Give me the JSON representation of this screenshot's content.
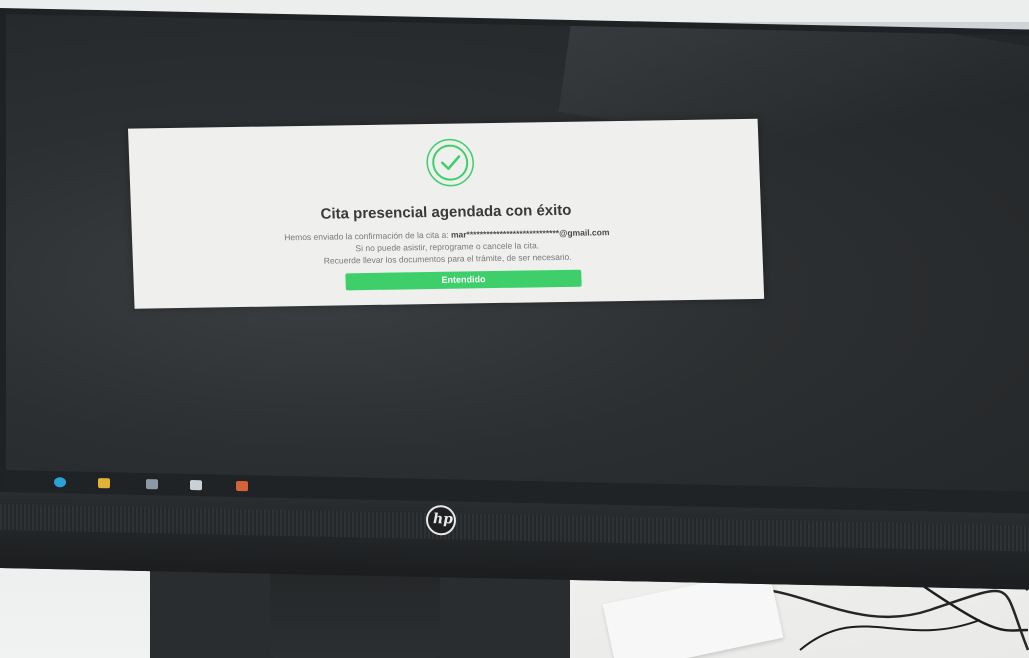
{
  "dialog": {
    "title": "Cita presencial agendada con éxito",
    "line1_prefix": "Hemos enviado la confirmación de la cita a: ",
    "line1_email": "mar****************************@gmail.com",
    "line2": "Si no puede asistir, reprograme o cancele la cita.",
    "line3": "Recuerde llevar los documentos para el trámite, de ser necesario.",
    "button_label": "Entendido",
    "icon": "check-circle-icon",
    "accent_color": "#3ecf6b"
  },
  "monitor": {
    "brand_logo_text": "hp"
  },
  "taskbar": {
    "icons": [
      "chrome-icon",
      "folder-icon",
      "store-icon",
      "mail-icon",
      "app-icon"
    ]
  }
}
